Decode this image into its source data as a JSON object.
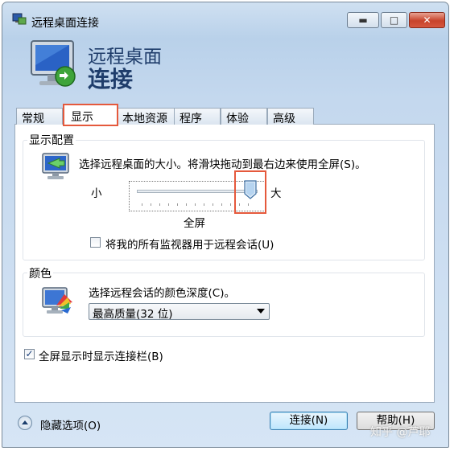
{
  "window": {
    "title": "远程桌面连接",
    "min_glyph": "▬",
    "max_glyph": "□",
    "close_glyph": "✕"
  },
  "header": {
    "line1": "远程桌面",
    "line2": "连接"
  },
  "tabs": [
    "常规",
    "显示",
    "本地资源",
    "程序",
    "体验",
    "高级"
  ],
  "active_tab": "显示",
  "display_config": {
    "group_label": "显示配置",
    "description": "选择远程桌面的大小。将滑块拖动到最右边来使用全屏(S)。",
    "small_label": "小",
    "large_label": "大",
    "value_label": "全屏",
    "slider_value": 1.0,
    "all_monitors_label": "将我的所有监视器用于远程会话(U)",
    "all_monitors_checked": false
  },
  "color": {
    "group_label": "颜色",
    "description": "选择远程会话的颜色深度(C)。",
    "selected": "最高质量(32 位)"
  },
  "fullscreen_bar": {
    "label": "全屏显示时显示连接栏(B)",
    "checked": true,
    "check_glyph": "✓"
  },
  "footer": {
    "options_label": "隐藏选项(O)",
    "connect_label": "连接(N)",
    "help_label": "帮助(H)"
  },
  "watermark": "知乎 @芦耶",
  "colors": {
    "accent_highlight": "#e5593c",
    "title_text": "#1f3d6b"
  }
}
